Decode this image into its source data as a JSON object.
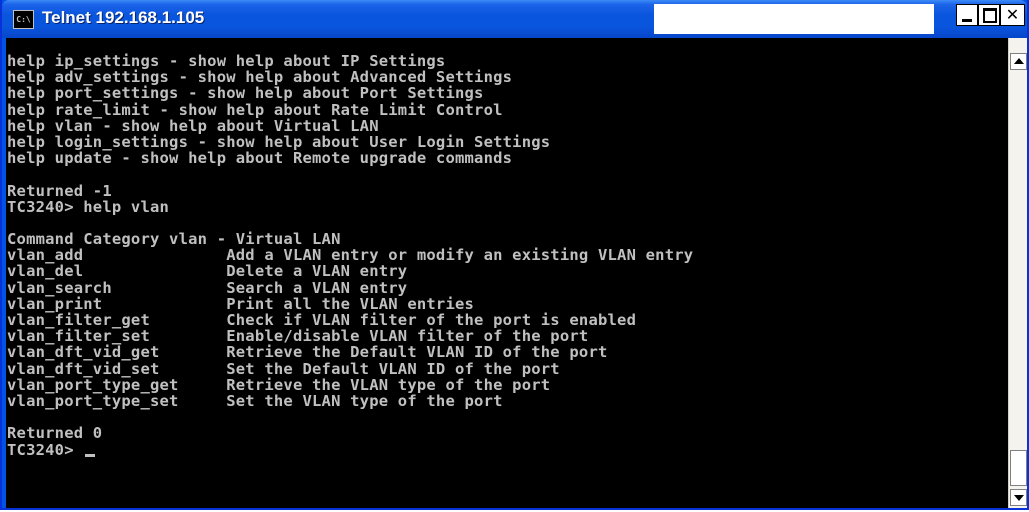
{
  "window": {
    "title": "Telnet 192.168.1.105",
    "icon_label": "C:\\",
    "icon": "console-icon",
    "controls": {
      "minimize_icon": "minimize-icon",
      "maximize_icon": "maximize-icon",
      "close_label": "✕"
    }
  },
  "console": {
    "lines": [
      "help ip_settings - show help about IP Settings",
      "help adv_settings - show help about Advanced Settings",
      "help port_settings - show help about Port Settings",
      "help rate_limit - show help about Rate Limit Control",
      "help vlan - show help about Virtual LAN",
      "help login_settings - show help about User Login Settings",
      "help update - show help about Remote upgrade commands",
      "",
      "Returned -1",
      "TC3240> help vlan",
      "",
      "Command Category vlan - Virtual LAN",
      "vlan_add               Add a VLAN entry or modify an existing VLAN entry",
      "vlan_del               Delete a VLAN entry",
      "vlan_search            Search a VLAN entry",
      "vlan_print             Print all the VLAN entries",
      "vlan_filter_get        Check if VLAN filter of the port is enabled",
      "vlan_filter_set        Enable/disable VLAN filter of the port",
      "vlan_dft_vid_get       Retrieve the Default VLAN ID of the port",
      "vlan_dft_vid_set       Set the Default VLAN ID of the port",
      "vlan_port_type_get     Retrieve the VLAN type of the port",
      "vlan_port_type_set     Set the VLAN type of the port",
      "",
      "Returned 0"
    ],
    "prompt": "TC3240> "
  },
  "colors": {
    "titlebar": "#0a55de",
    "console_bg": "#000000",
    "console_fg": "#c0c0c0"
  }
}
